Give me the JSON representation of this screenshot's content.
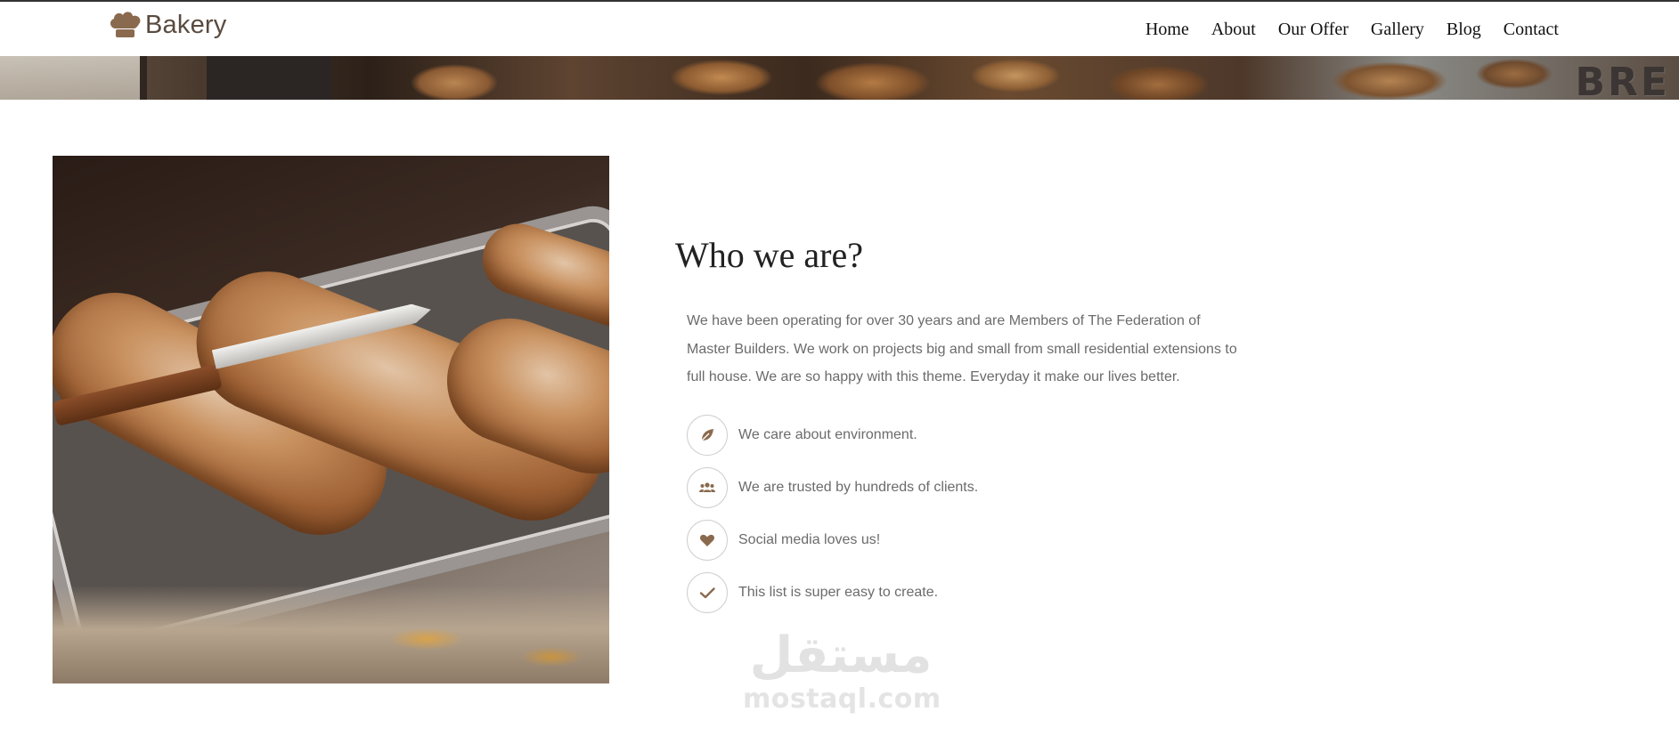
{
  "brand": {
    "name": "Bakery",
    "logo_icon": "chef-hat-icon",
    "color": "#8a6a4e"
  },
  "nav": {
    "items": [
      {
        "label": "Home"
      },
      {
        "label": "About"
      },
      {
        "label": "Our Offer"
      },
      {
        "label": "Gallery"
      },
      {
        "label": "Blog"
      },
      {
        "label": "Contact"
      }
    ]
  },
  "hero": {
    "banner_text": "BRE"
  },
  "about": {
    "title": "Who we are?",
    "paragraph": "We have been operating for over 30 years and are Members of The Federation of Master Builders. We work on projects big and small from small residential extensions to full house. We are so happy with this theme. Everyday it make our lives better.",
    "features": [
      {
        "icon": "leaf-icon",
        "text": "We care about environment."
      },
      {
        "icon": "users-icon",
        "text": "We are trusted by hundreds of clients."
      },
      {
        "icon": "heart-icon",
        "text": "Social media loves us!"
      },
      {
        "icon": "check-icon",
        "text": "This list is super easy to create."
      }
    ]
  },
  "watermark": {
    "arabic": "مستقل",
    "latin": "mostaql.com"
  },
  "colors": {
    "accent": "#8a6a4e",
    "text_muted": "#6b6b6b",
    "heading": "#222222"
  }
}
